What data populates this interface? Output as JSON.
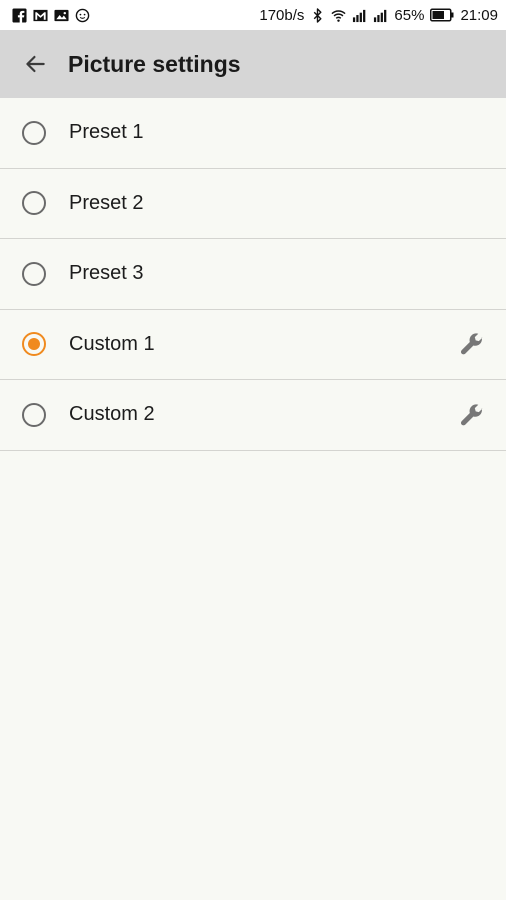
{
  "status_bar": {
    "net_speed": "170b/s",
    "battery_percent": "65%",
    "time": "21:09",
    "left_icons": [
      "facebook-icon",
      "gmail-icon",
      "gallery-icon",
      "face-icon"
    ],
    "right_icons": [
      "bluetooth-icon",
      "wifi-icon",
      "signal-icon",
      "signal-icon",
      "battery-icon"
    ]
  },
  "app_bar": {
    "title": "Picture settings",
    "back_icon": "arrow-back-icon"
  },
  "options": [
    {
      "label": "Preset 1",
      "selected": false,
      "editable": false
    },
    {
      "label": "Preset 2",
      "selected": false,
      "editable": false
    },
    {
      "label": "Preset 3",
      "selected": false,
      "editable": false
    },
    {
      "label": "Custom 1",
      "selected": true,
      "editable": true
    },
    {
      "label": "Custom 2",
      "selected": false,
      "editable": true
    }
  ],
  "colors": {
    "accent": "#f08a1e",
    "app_bar_bg": "#d6d6d6",
    "background": "#f8f9f4"
  }
}
